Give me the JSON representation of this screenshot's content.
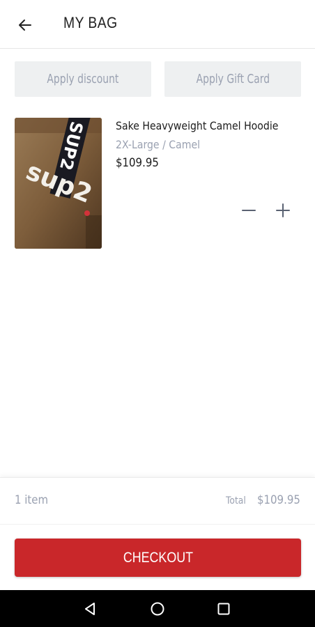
{
  "header": {
    "title": "MY BAG",
    "back_icon": "arrow-left-icon"
  },
  "actions": {
    "discount_label": "Apply discount",
    "gift_card_label": "Apply Gift Card"
  },
  "cart": {
    "items": [
      {
        "name": "Sake Heavyweight Camel Hoodie",
        "variant": "2X-Large / Camel",
        "price": "$109.95",
        "image": {
          "logo_text": "sup2",
          "strap_text": "SUP2"
        }
      }
    ]
  },
  "summary": {
    "count": "1 item",
    "total_label": "Total",
    "total_value": "$109.95"
  },
  "checkout": {
    "label": "CHECKOUT"
  },
  "colors": {
    "accent": "#c9272a",
    "muted": "#9aa1b1",
    "pill_bg": "#eef0f1",
    "nav_bg": "#000000"
  },
  "system_nav": {
    "icons": [
      "nav-back-icon",
      "nav-home-icon",
      "nav-recents-icon"
    ]
  }
}
